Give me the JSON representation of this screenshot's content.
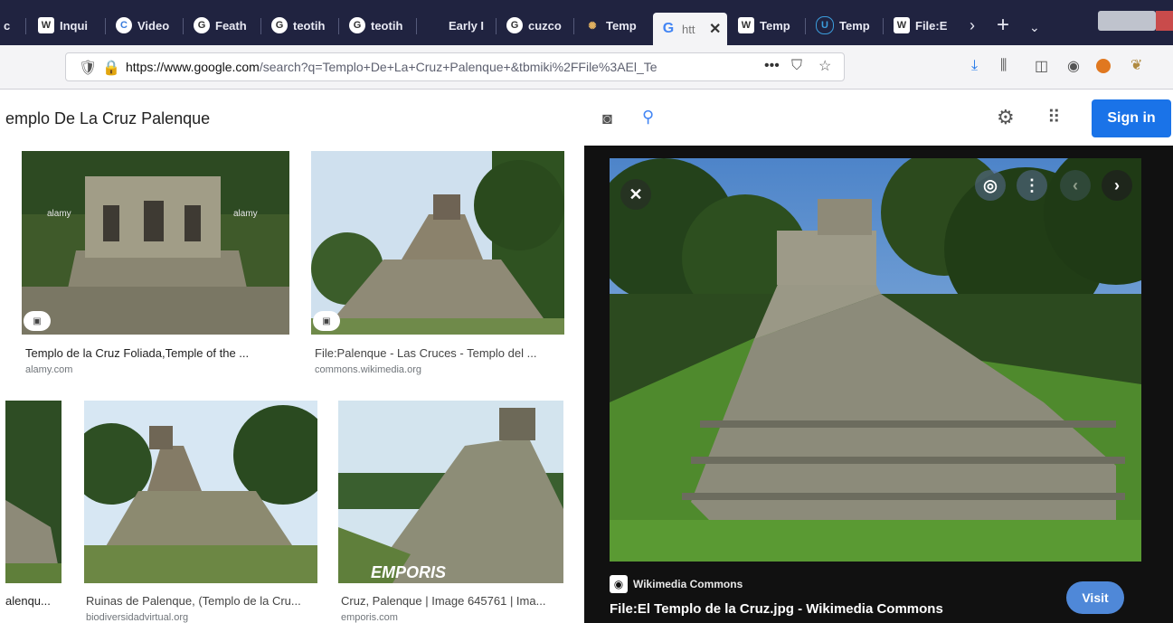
{
  "tabs": [
    {
      "label": "Inqui",
      "icon": "W",
      "color": "#ffffff"
    },
    {
      "label": "Video",
      "icon": "C",
      "color": "#3b7ddd"
    },
    {
      "label": "Feath",
      "icon": "G",
      "color": "#ffffff"
    },
    {
      "label": "teotih",
      "icon": "G",
      "color": "#ffffff"
    },
    {
      "label": "teotih",
      "icon": "G",
      "color": "#ffffff"
    },
    {
      "label": "Early I",
      "icon": "",
      "color": "#ffffff"
    },
    {
      "label": "cuzco",
      "icon": "G",
      "color": "#ffffff"
    },
    {
      "label": "Temp",
      "icon": "✺",
      "color": "#e0b060"
    },
    {
      "label": "htt",
      "icon": "G",
      "color": "#4285f4"
    },
    {
      "label": "Temp",
      "icon": "W",
      "color": "#ffffff"
    },
    {
      "label": "Temp",
      "icon": "U",
      "color": "#3b9ddd"
    },
    {
      "label": "File:E",
      "icon": "W",
      "color": "#ffffff"
    }
  ],
  "url": {
    "domain": "https://www.google.com",
    "rest": "/search?q=Templo+De+La+Cruz+Palenque+&tbmiki%2FFile%3AEl_Te",
    "more": "•••"
  },
  "search": {
    "query": "emplo De La Cruz Palenque",
    "signin": "Sign in"
  },
  "results": [
    {
      "caption": "Templo de la Cruz Foliada,Temple of the ...",
      "source": "alamy.com"
    },
    {
      "caption": "File:Palenque - Las Cruces - Templo del ...",
      "source": "commons.wikimedia.org"
    },
    {
      "caption": "alenqu...",
      "source": ""
    },
    {
      "caption": "Ruinas de Palenque, (Templo de la Cru...",
      "source": "biodiversidadvirtual.org"
    },
    {
      "caption": "Cruz, Palenque | Image 645761 | Ima...",
      "source": "emporis.com"
    }
  ],
  "watermarks": {
    "alamy1": "alamy",
    "alamy2": "alamy",
    "emporis": "EMPORIS"
  },
  "preview": {
    "site": "Wikimedia Commons",
    "title": "File:El Templo de la Cruz.jpg - Wikimedia Commons",
    "visit": "Visit"
  },
  "colors": {
    "tabbar": "#202340",
    "accent": "#1a73e8",
    "panel": "#111111"
  }
}
